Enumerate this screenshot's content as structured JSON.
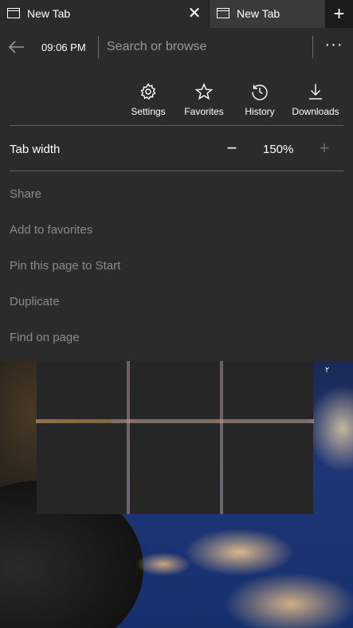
{
  "tabs": {
    "active": {
      "title": "New Tab",
      "close": "✕"
    },
    "inactive": {
      "title": "New Tab"
    },
    "new_tab": "+"
  },
  "addressbar": {
    "time": "09:06 PM",
    "search_placeholder": "Search or browse",
    "more": "···"
  },
  "quick_actions": [
    {
      "label": "Settings",
      "icon": "gear-icon"
    },
    {
      "label": "Favorites",
      "icon": "star-icon"
    },
    {
      "label": "History",
      "icon": "history-icon"
    },
    {
      "label": "Downloads",
      "icon": "download-icon"
    }
  ],
  "tab_width": {
    "label": "Tab width",
    "minus": "−",
    "value": "150%",
    "plus": "+"
  },
  "menu_items": [
    "Share",
    "Add to favorites",
    "Pin this page to Start",
    "Duplicate",
    "Find on page"
  ],
  "background": {
    "mark": "۲"
  },
  "colors": {
    "chrome": "#2b2b2b",
    "tabstrip": "#1b1b1b",
    "inactive_tab": "#3a3a3a",
    "menu_text_dim": "#8a8a8a",
    "tile": "#262626"
  }
}
